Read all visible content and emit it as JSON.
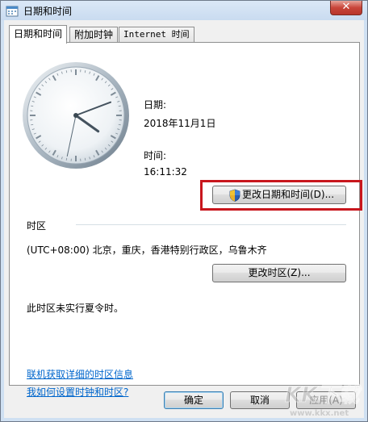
{
  "window": {
    "title": "日期和时间",
    "close_symbol": "✕"
  },
  "tabs": [
    {
      "label": "日期和时间",
      "active": true
    },
    {
      "label": "附加时钟",
      "active": false
    },
    {
      "label": "Internet 时间",
      "active": false
    }
  ],
  "datetime": {
    "date_label": "日期:",
    "date_value": "2018年11月1日",
    "time_label": "时间:",
    "time_value": "16:11:32",
    "clock_time": {
      "hour": 16,
      "minute": 11,
      "second": 32
    },
    "change_button": "更改日期和时间(D)..."
  },
  "timezone": {
    "section_label": "时区",
    "value": "(UTC+08:00) 北京，重庆，香港特别行政区，乌鲁木齐",
    "change_button": "更改时区(Z)...",
    "dst_note": "此时区未实行夏令时。"
  },
  "links": {
    "online_info": "联机获取详细的时区信息",
    "how_to": "我如何设置时钟和时区?"
  },
  "footer": {
    "ok_button": "确定",
    "cancel_button": "取消",
    "apply_button": "应用(A)"
  },
  "watermark": {
    "brand": "KK下载",
    "url": "www.kkx.net"
  },
  "icons": {
    "window": "calendar-clock-icon",
    "uac": "uac-shield-icon"
  },
  "colors": {
    "highlight_box": "#c8161d",
    "link": "#0066cc"
  }
}
